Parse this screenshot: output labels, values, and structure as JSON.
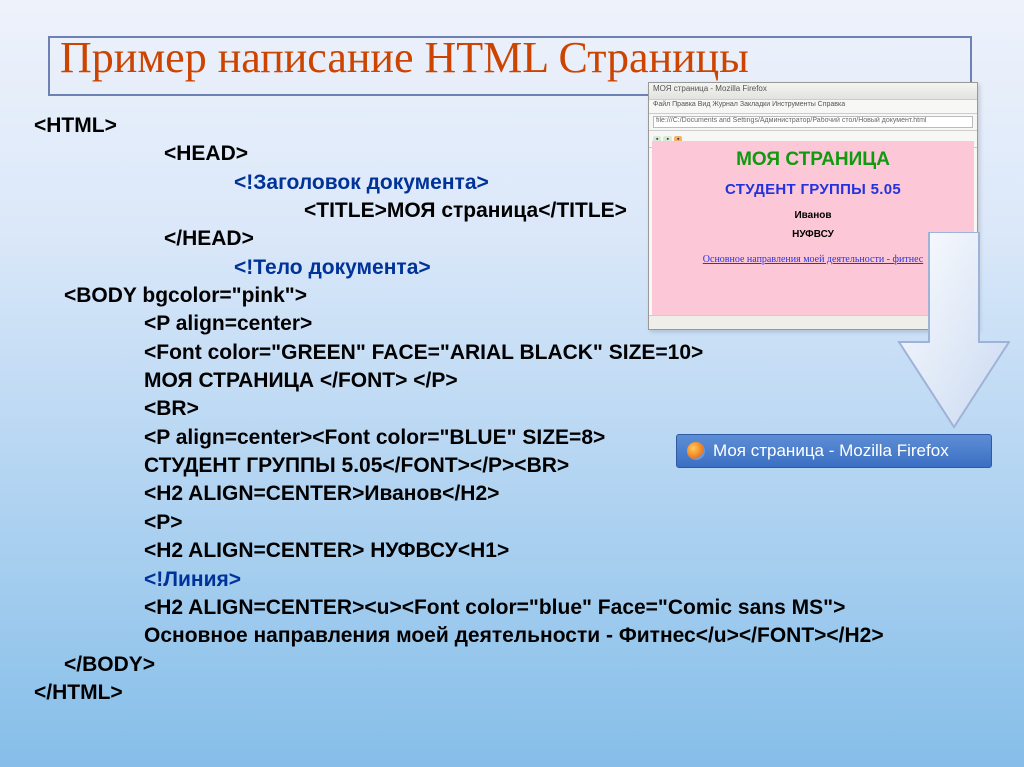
{
  "slide_title": "Пример написание HTML Страницы",
  "code": {
    "html_open": "<HTML>",
    "head_open": "<HEAD>",
    "doc_head_comment": "<!Заголовок документа>",
    "title_line": "<TITLE>МОЯ страница</TITLE>",
    "head_close": "</HEAD>",
    "doc_body_comment": "<!Тело документа>",
    "body_open": "<BODY bgcolor=\"pink\">",
    "p1": "<P align=center>",
    "font1": "<Font color=\"GREEN\" FACE=\"ARIAL BLACK\" SIZE=10>",
    "font1_close": "МОЯ СТРАНИЦА </FONT> </P>",
    "br": "<BR>",
    "p2": "<P align=center><Font color=\"BLUE\" SIZE=8>",
    "p2_close": "СТУДЕНТ ГРУППЫ 5.05</FONT></P><BR>",
    "h2_ivanov": "<H2 ALIGN=CENTER>Иванов</H2>",
    "p_empty": "<P>",
    "h2_nufvsu": "<H2 ALIGN=CENTER> НУФВСУ<H1>",
    "line_comment": "<!Линия>",
    "h2_link": "<H2 ALIGN=CENTER><u><Font color=\"blue\" Face=\"Comic sans MS\">",
    "h2_link_text": "Основное направления моей деятельности - Фитнес</u></FONT></H2>",
    "body_close": "</BODY>",
    "html_close": "</HTML>"
  },
  "preview": {
    "titlebar": "МОЯ страница - Mozilla Firefox",
    "menubar": "Файл  Правка  Вид  Журнал  Закладки  Инструменты  Справка",
    "url": "file:///C:/Documents and Settings/Администратор/Рабочий стол/Новый документ.html",
    "h1": "МОЯ СТРАНИЦА",
    "h2": "СТУДЕНТ ГРУППЫ 5.05",
    "l1": "Иванов",
    "l2": "НУФВСУ",
    "link": "Основное направления моей деятельности  -  фитнес"
  },
  "taskbar": {
    "label": "Моя страница - Mozilla Firefox"
  }
}
